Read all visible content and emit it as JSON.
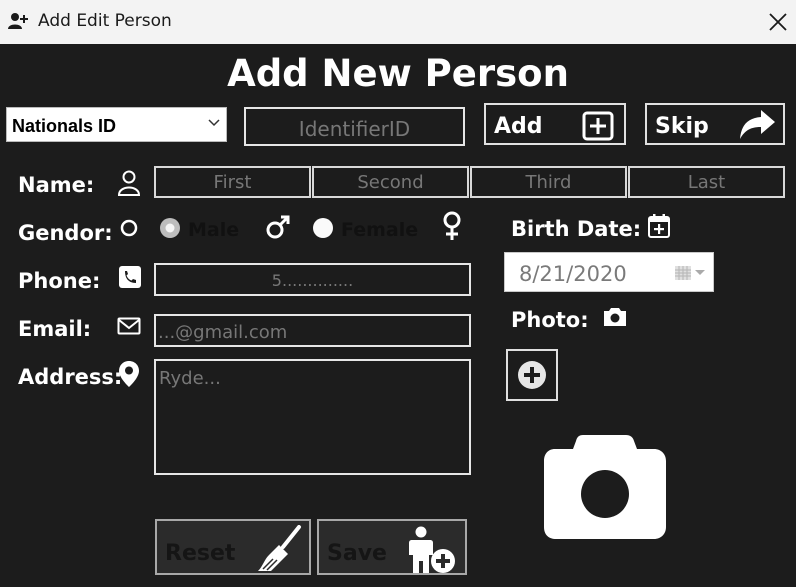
{
  "window": {
    "title": "Add Edit Person"
  },
  "heading": "Add New Person",
  "identifier": {
    "type_selected": "Nationals ID",
    "id_placeholder": "IdentifierID",
    "add_label": "Add",
    "skip_label": "Skip"
  },
  "name": {
    "label": "Name:",
    "first_placeholder": "First",
    "second_placeholder": "Second",
    "third_placeholder": "Third",
    "last_placeholder": "Last"
  },
  "gender": {
    "label": "Gendor:",
    "male_label": "Male",
    "female_label": "Female",
    "selected": "Male"
  },
  "birth_date": {
    "label": "Birth Date:",
    "value": "8/21/2020"
  },
  "phone": {
    "label": "Phone:",
    "placeholder": "5.............."
  },
  "email": {
    "label": "Email:",
    "placeholder": "...@gmail.com"
  },
  "address": {
    "label": "Address:",
    "placeholder": "Ryde..."
  },
  "photo": {
    "label": "Photo:"
  },
  "actions": {
    "reset_label": "Reset",
    "save_label": "Save",
    "reset_enabled": false,
    "save_enabled": false
  },
  "icons": {
    "window": "person-add-icon",
    "close": "close-icon",
    "add": "plus-square-icon",
    "skip": "share-arrow-icon",
    "name": "person-outline-icon",
    "gender": "circle-icon",
    "male": "male-symbol-icon",
    "female": "female-symbol-icon",
    "birth_date": "calendar-add-icon",
    "phone": "phone-icon",
    "email": "envelope-icon",
    "address": "map-pin-icon",
    "photo": "camera-icon",
    "add_photo": "plus-circle-icon",
    "photo_placeholder": "camera-icon",
    "reset": "broom-icon",
    "save": "person-add-icon"
  },
  "colors": {
    "background": "#1c1c1c",
    "titlebar": "#f3f3f3",
    "text": "#ffffff",
    "border": "#e6e6e6",
    "placeholder": "#777777"
  }
}
